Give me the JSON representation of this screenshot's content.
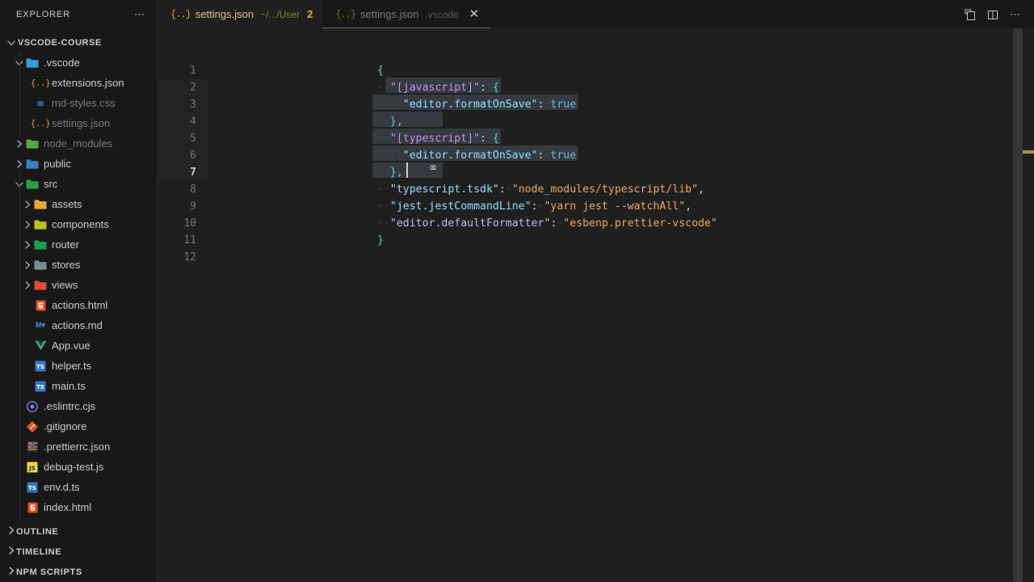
{
  "sidebar": {
    "title": "EXPLORER",
    "more_icon": "ellipsis-icon",
    "root": {
      "label": "VSCODE-COURSE",
      "expanded": true
    },
    "items": [
      {
        "label": ".vscode",
        "type": "folder",
        "depth": 1,
        "expanded": true,
        "icon": "folder-vscode-icon",
        "color": "#3b9ad9",
        "dim": false
      },
      {
        "label": "extensions.json",
        "type": "file",
        "depth": 2,
        "icon": "json-icon",
        "color": "#cbb41f",
        "dim": false
      },
      {
        "label": "md-styles.css",
        "type": "file",
        "depth": 2,
        "icon": "css-icon",
        "color": "#2f7fd1",
        "dim": true
      },
      {
        "label": "settings.json",
        "type": "file",
        "depth": 2,
        "icon": "json-icon",
        "color": "#cbb41f",
        "dim": true
      },
      {
        "label": "node_modules",
        "type": "folder",
        "depth": 1,
        "expanded": false,
        "icon": "folder-node-icon",
        "color": "#57a64a",
        "dim": true
      },
      {
        "label": "public",
        "type": "folder",
        "depth": 1,
        "expanded": false,
        "icon": "folder-public-icon",
        "color": "#3b82c4",
        "dim": false
      },
      {
        "label": "src",
        "type": "folder",
        "depth": 1,
        "expanded": true,
        "icon": "folder-src-icon",
        "color": "#2f9e44",
        "dim": false
      },
      {
        "label": "assets",
        "type": "folder",
        "depth": 2,
        "expanded": false,
        "icon": "folder-assets-icon",
        "color": "#e8a93a",
        "dim": false
      },
      {
        "label": "components",
        "type": "folder",
        "depth": 2,
        "expanded": false,
        "icon": "folder-components-icon",
        "color": "#b5c718",
        "dim": false
      },
      {
        "label": "router",
        "type": "folder",
        "depth": 2,
        "expanded": false,
        "icon": "folder-router-icon",
        "color": "#1f9d4e",
        "dim": false
      },
      {
        "label": "stores",
        "type": "folder",
        "depth": 2,
        "expanded": false,
        "icon": "folder-generic-icon",
        "color": "#7b8f96",
        "dim": false
      },
      {
        "label": "views",
        "type": "folder",
        "depth": 2,
        "expanded": false,
        "icon": "folder-views-icon",
        "color": "#e04a3a",
        "dim": false
      },
      {
        "label": "actions.html",
        "type": "file",
        "depth": 2,
        "icon": "html-icon",
        "color": "#e34c26",
        "dim": false
      },
      {
        "label": "actions.md",
        "type": "file",
        "depth": 2,
        "icon": "markdown-icon",
        "color": "#4a90d9",
        "dim": false
      },
      {
        "label": "App.vue",
        "type": "file",
        "depth": 2,
        "icon": "vue-icon",
        "color": "#41b883",
        "dim": false
      },
      {
        "label": "helper.ts",
        "type": "file",
        "depth": 2,
        "icon": "typescript-icon",
        "color": "#3178c6",
        "dim": false
      },
      {
        "label": "main.ts",
        "type": "file",
        "depth": 2,
        "icon": "typescript-icon",
        "color": "#3178c6",
        "dim": false
      },
      {
        "label": ".eslintrc.cjs",
        "type": "file",
        "depth": 1,
        "icon": "eslint-icon",
        "color": "#8080f2",
        "dim": false
      },
      {
        "label": ".gitignore",
        "type": "file",
        "depth": 1,
        "icon": "git-icon",
        "color": "#e8542a",
        "dim": false
      },
      {
        "label": ".prettierrc.json",
        "type": "file",
        "depth": 1,
        "icon": "prettier-icon",
        "color": "#b5b5b5",
        "dim": false
      },
      {
        "label": "debug-test.js",
        "type": "file",
        "depth": 1,
        "icon": "javascript-icon",
        "color": "#e8d44d",
        "dim": false
      },
      {
        "label": "env.d.ts",
        "type": "file",
        "depth": 1,
        "icon": "typescript-icon",
        "color": "#3178c6",
        "dim": false
      },
      {
        "label": "index.html",
        "type": "file",
        "depth": 1,
        "icon": "html-icon",
        "color": "#e34c26",
        "dim": false
      }
    ],
    "sections": [
      {
        "label": "OUTLINE",
        "expanded": false
      },
      {
        "label": "TIMELINE",
        "expanded": false
      },
      {
        "label": "NPM SCRIPTS",
        "expanded": false
      }
    ]
  },
  "tabs": [
    {
      "name": "settings.json",
      "path": "~/.../User",
      "badge": "2",
      "active": true,
      "dirty": false,
      "closable": false
    },
    {
      "name": "settings.json",
      "path": ".vscode",
      "badge": "",
      "active": false,
      "dirty": false,
      "closable": true,
      "close_label": "✕"
    }
  ],
  "tabbar_actions": [
    {
      "name": "split-editor-down-icon"
    },
    {
      "name": "split-editor-right-icon"
    },
    {
      "name": "more-actions-icon"
    }
  ],
  "editor": {
    "language": "json",
    "active_line": 7,
    "cursor": {
      "line": 7,
      "column": 4
    },
    "mouse_pointer": "text-ibeam",
    "total_lines": 12,
    "line_numbers": [
      "1",
      "2",
      "3",
      "4",
      "5",
      "6",
      "7",
      "8",
      "9",
      "10",
      "11",
      "12"
    ],
    "lines": [
      {
        "n": 1,
        "text": "{"
      },
      {
        "n": 2,
        "text": "  \"[javascript]\": {"
      },
      {
        "n": 3,
        "text": "    \"editor.formatOnSave\": true"
      },
      {
        "n": 4,
        "text": "  },"
      },
      {
        "n": 5,
        "text": "  \"[typescript]\": {"
      },
      {
        "n": 6,
        "text": "    \"editor.formatOnSave\": true"
      },
      {
        "n": 7,
        "text": "  },"
      },
      {
        "n": 8,
        "text": "  \"typescript.tsdk\": \"node_modules/typescript/lib\","
      },
      {
        "n": 9,
        "text": "  \"jest.jestCommandLine\": \"yarn jest --watchAll\","
      },
      {
        "n": 10,
        "text": "  \"editor.defaultFormatter\": \"esbenp.prettier-vscode\""
      },
      {
        "n": 11,
        "text": "}"
      },
      {
        "n": 12,
        "text": ""
      }
    ],
    "selection": {
      "from_line": 2,
      "to_line": 7,
      "active": true
    },
    "ruler_marks": [
      {
        "line": 6,
        "color": "#9a9a4a"
      }
    ]
  },
  "colors": {
    "editor_bg": "#1f1f1f",
    "sidebar_bg": "#181818",
    "selection": "#343a40",
    "accent": "#0078d4",
    "json_key": "#9cdcfe",
    "json_string": "#e8a96c",
    "json_bool": "#6fb8e0",
    "brace": "#5fd7c8",
    "ruler_mark": "#9a9a4a"
  }
}
